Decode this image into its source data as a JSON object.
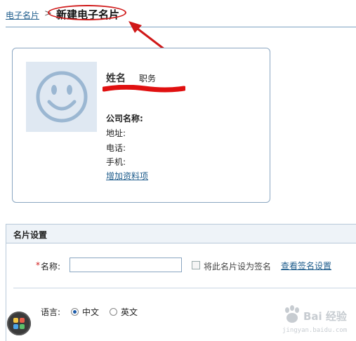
{
  "breadcrumb": {
    "parent": "电子名片",
    "separator": ">",
    "current": "新建电子名片"
  },
  "card": {
    "name_label": "姓名",
    "title_label": "职务",
    "company_label": "公司名称:",
    "address_label": "地址:",
    "phone_label": "电话:",
    "mobile_label": "手机:",
    "add_fields_link": "增加资料项"
  },
  "settings": {
    "section_title": "名片设置",
    "required_mark": "*",
    "name_label": "名称:",
    "name_value": "",
    "signature_checkbox_label": "将此名片设为签名",
    "signature_checked": false,
    "view_signature_link": "查看签名设置",
    "language_label": "语言:",
    "language_options": [
      "中文",
      "英文"
    ],
    "language_selected": "中文"
  },
  "watermark": {
    "text": "Bai 经验",
    "url": "jingyan.baidu.com"
  },
  "icons": {
    "avatar": "smiley-face-icon",
    "app_launcher": "app-grid-icon"
  },
  "colors": {
    "link": "#1f5d8c",
    "highlight_ellipse": "#d01818",
    "card_border": "#8aa6c1",
    "avatar_bg": "#dfe8f2"
  }
}
